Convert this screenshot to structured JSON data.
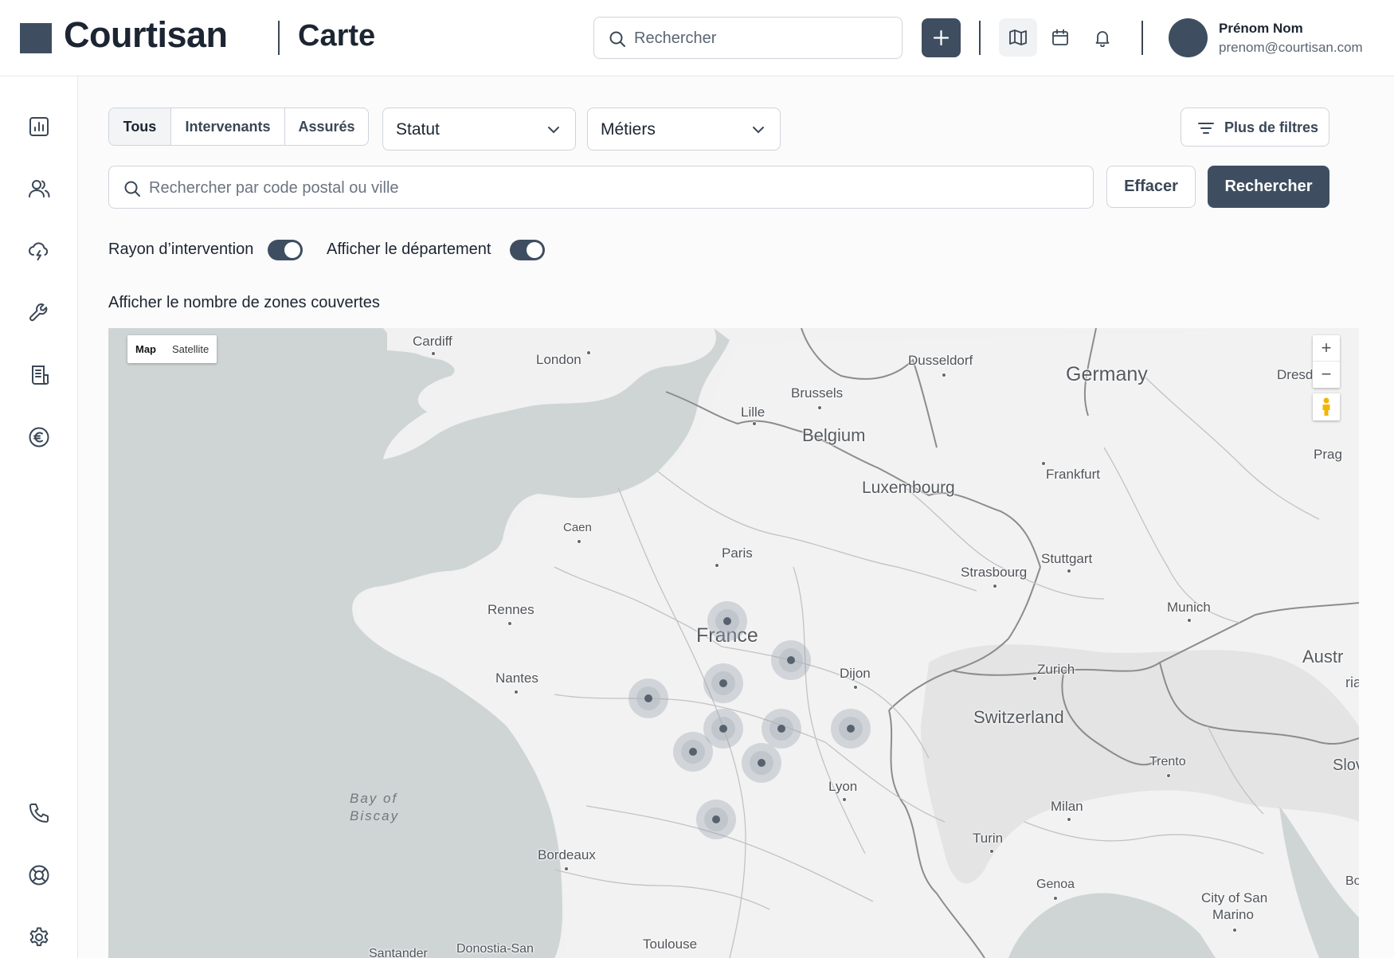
{
  "header": {
    "logo_text": "Courtisan",
    "page_title": "Carte",
    "search_placeholder": "Rechercher",
    "user": {
      "name": "Prénom Nom",
      "email": "prenom@courtisan.com"
    },
    "icons": [
      "plus-icon",
      "map-icon",
      "calendar-icon",
      "bell-icon"
    ]
  },
  "sidebar": {
    "items": [
      "chart-icon",
      "users-icon",
      "cloud-lightning-icon",
      "wrench-icon",
      "document-icon",
      "euro-icon"
    ],
    "bottom_items": [
      "phone-icon",
      "lifebuoy-icon",
      "gear-icon"
    ]
  },
  "filters": {
    "segments": [
      {
        "label": "Tous",
        "active": true
      },
      {
        "label": "Intervenants",
        "active": false
      },
      {
        "label": "Assurés",
        "active": false
      }
    ],
    "status_select": "Statut",
    "trades_select": "Métiers",
    "more_filters": "Plus de filtres",
    "postal_placeholder": "Rechercher par code postal ou ville",
    "clear_label": "Effacer",
    "search_label": "Rechercher",
    "toggles": [
      {
        "label": "Rayon d’intervention",
        "on": true
      },
      {
        "label": "Afficher le département",
        "on": true
      }
    ],
    "zones_label": "Afficher le nombre de zones couvertes"
  },
  "map": {
    "type_options": [
      {
        "label": "Map",
        "active": true
      },
      {
        "label": "Satellite",
        "active": false
      }
    ],
    "zoom_in": "+",
    "zoom_out": "−",
    "labels": {
      "cardiff": "Cardiff",
      "london": "London",
      "dusseldorf": "Dusseldorf",
      "germany": "Germany",
      "dresden": "Dresd",
      "brussels": "Brussels",
      "lille": "Lille",
      "belgium": "Belgium",
      "prague": "Prag",
      "frankfurt": "Frankfurt",
      "luxembourg": "Luxembourg",
      "caen": "Caen",
      "paris": "Paris",
      "stuttgart": "Stuttgart",
      "strasbourg": "Strasbourg",
      "rennes": "Rennes",
      "france": "France",
      "munich": "Munich",
      "austria": "Austr",
      "austria_2": "ria",
      "nantes": "Nantes",
      "dijon": "Dijon",
      "zurich": "Zurich",
      "switzerland": "Switzerland",
      "slovenia": "Slov",
      "trento": "Trento",
      "lyon": "Lyon",
      "bay_of_biscay_1": "Bay of",
      "bay_of_biscay_2": "Biscay",
      "milan": "Milan",
      "turin": "Turin",
      "bordeaux": "Bordeaux",
      "genoa": "Genoa",
      "san_marino_1": "City of San",
      "san_marino_2": "Marino",
      "bosnia": "Bo",
      "toulouse": "Toulouse",
      "santander": "Santander",
      "donostia": "Donostia-San"
    },
    "markers_count": 10
  }
}
